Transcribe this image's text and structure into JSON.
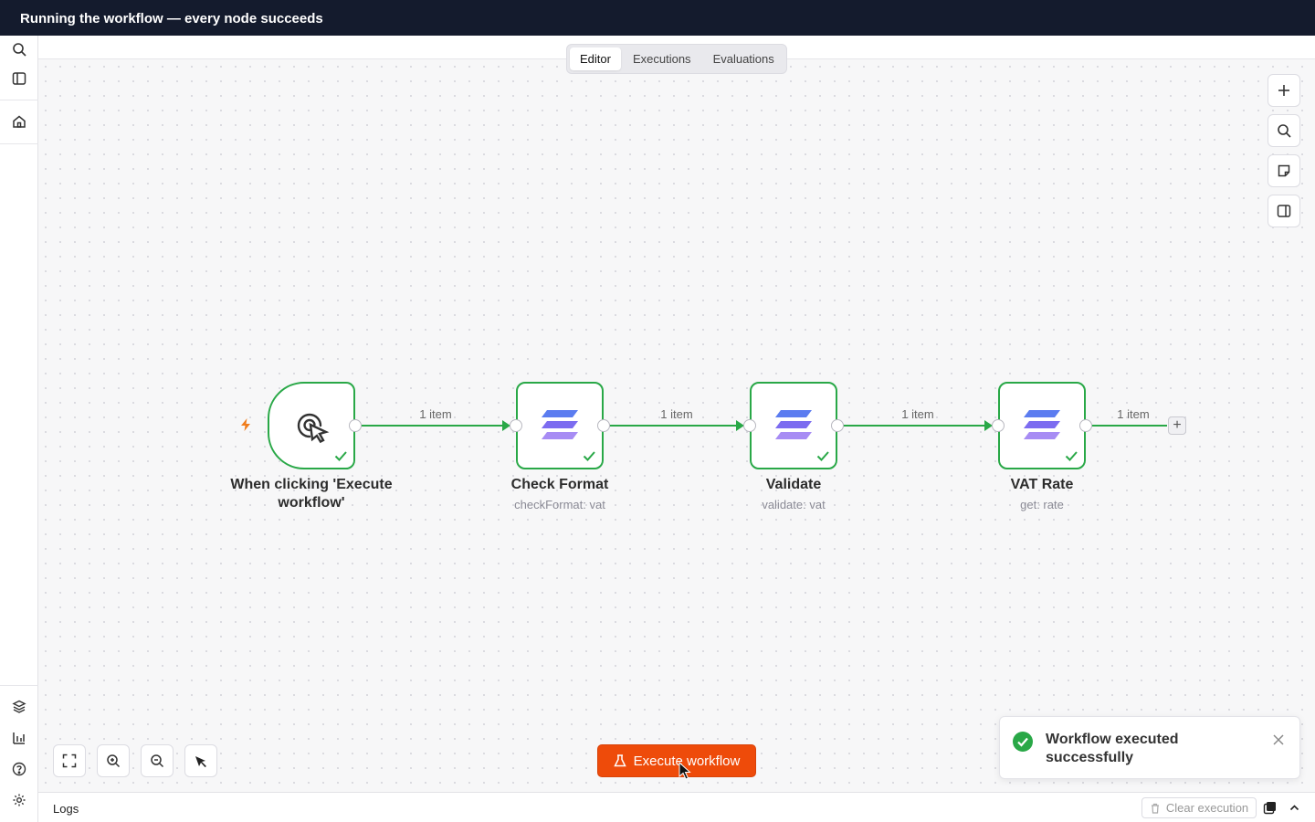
{
  "banner": {
    "title": "Running the workflow — every node succeeds"
  },
  "tabs": [
    {
      "label": "Editor",
      "active": true
    },
    {
      "label": "Executions",
      "active": false
    },
    {
      "label": "Evaluations",
      "active": false
    }
  ],
  "nodes": [
    {
      "title": "When clicking 'Execute workflow'",
      "subtitle": "",
      "icon": "cursor-click-icon",
      "status": "success"
    },
    {
      "title": "Check Format",
      "subtitle": "checkFormat: vat",
      "icon": "stack-icon",
      "status": "success"
    },
    {
      "title": "Validate",
      "subtitle": "validate: vat",
      "icon": "stack-icon",
      "status": "success"
    },
    {
      "title": "VAT Rate",
      "subtitle": "get: rate",
      "icon": "stack-icon",
      "status": "success"
    }
  ],
  "edges": [
    {
      "label": "1 item"
    },
    {
      "label": "1 item"
    },
    {
      "label": "1 item"
    },
    {
      "label": "1 item"
    }
  ],
  "execute_button": {
    "label": "Execute workflow"
  },
  "toast": {
    "message": "Workflow executed successfully"
  },
  "logs": {
    "title": "Logs",
    "clear_label": "Clear execution"
  },
  "colors": {
    "success": "#29a847",
    "execute": "#ee4b0a",
    "banner": "#141b2d",
    "trigger": "#f07c1b"
  }
}
